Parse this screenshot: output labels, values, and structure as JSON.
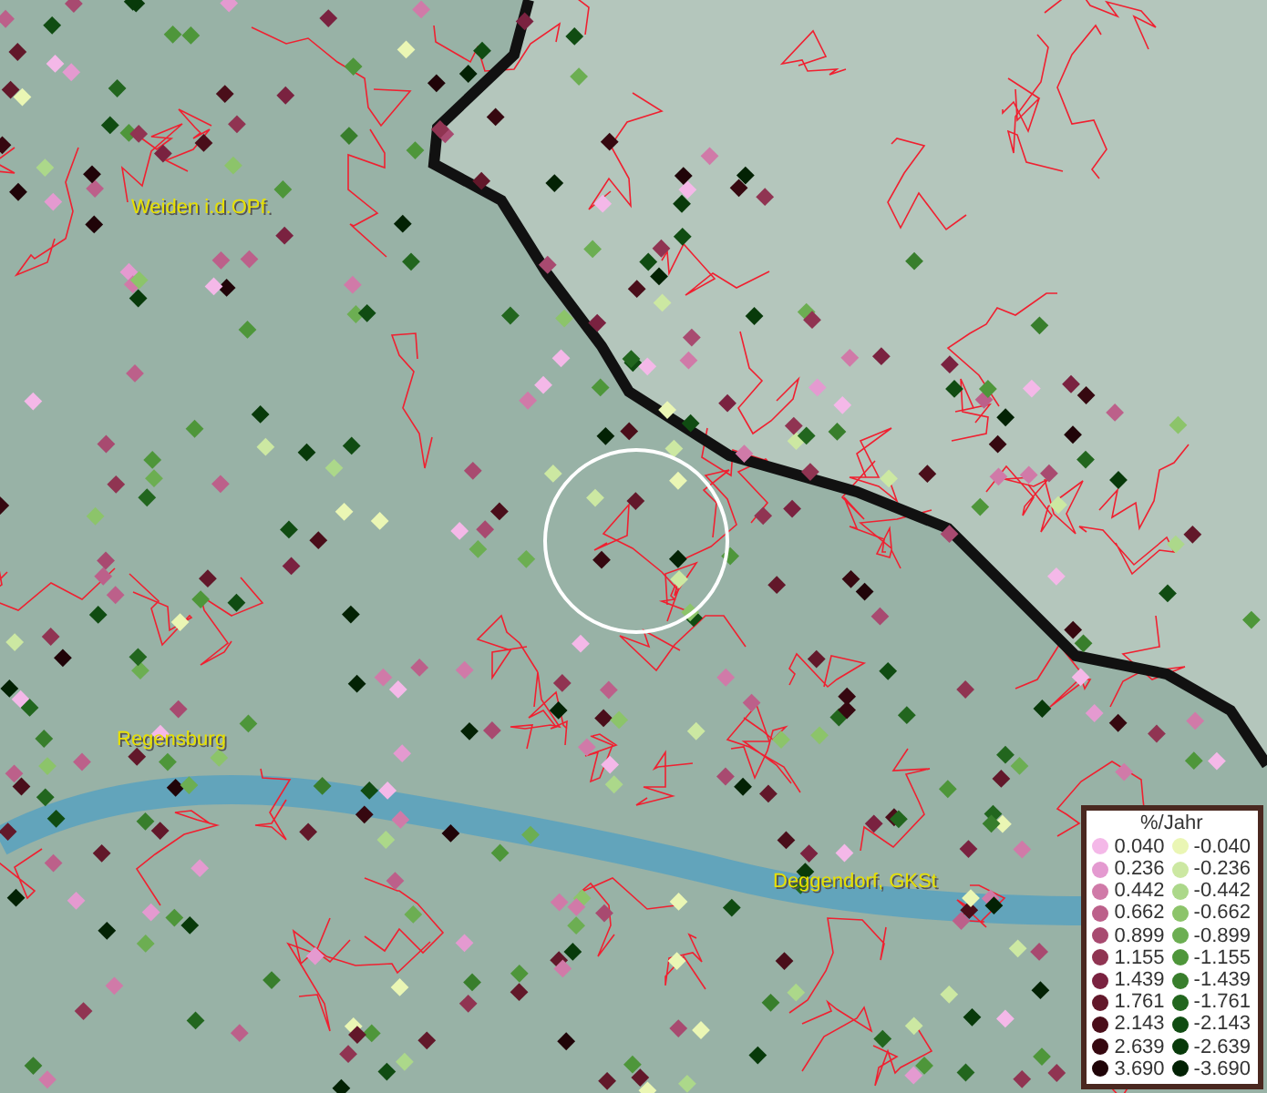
{
  "map": {
    "labels": [
      {
        "text": "Weiden i.d.OPf."
      },
      {
        "text": "Regensburg"
      },
      {
        "text": "Deggendorf, GKSt"
      }
    ]
  },
  "legend": {
    "title": "%/Jahr",
    "positive": [
      {
        "value": "0.040",
        "color": "#f4b8e8"
      },
      {
        "value": "0.236",
        "color": "#e49ad0"
      },
      {
        "value": "0.442",
        "color": "#d07aa8"
      },
      {
        "value": "0.662",
        "color": "#bc608a"
      },
      {
        "value": "0.899",
        "color": "#a84a70"
      },
      {
        "value": "1.155",
        "color": "#903452"
      },
      {
        "value": "1.439",
        "color": "#7a2240"
      },
      {
        "value": "1.761",
        "color": "#62182a"
      },
      {
        "value": "2.143",
        "color": "#4a0e1a"
      },
      {
        "value": "2.639",
        "color": "#360810"
      },
      {
        "value": "3.690",
        "color": "#200408"
      }
    ],
    "negative": [
      {
        "value": "-0.040",
        "color": "#eaf6b4"
      },
      {
        "value": "-0.236",
        "color": "#cce8a2"
      },
      {
        "value": "-0.442",
        "color": "#acd88a"
      },
      {
        "value": "-0.662",
        "color": "#8cc46a"
      },
      {
        "value": "-0.899",
        "color": "#6cae52"
      },
      {
        "value": "-1.155",
        "color": "#4e963a"
      },
      {
        "value": "-1.439",
        "color": "#387e2c"
      },
      {
        "value": "-1.761",
        "color": "#22661e"
      },
      {
        "value": "-2.143",
        "color": "#104c12"
      },
      {
        "value": "-2.639",
        "color": "#083a0a"
      },
      {
        "value": "-3.690",
        "color": "#032204"
      }
    ]
  }
}
